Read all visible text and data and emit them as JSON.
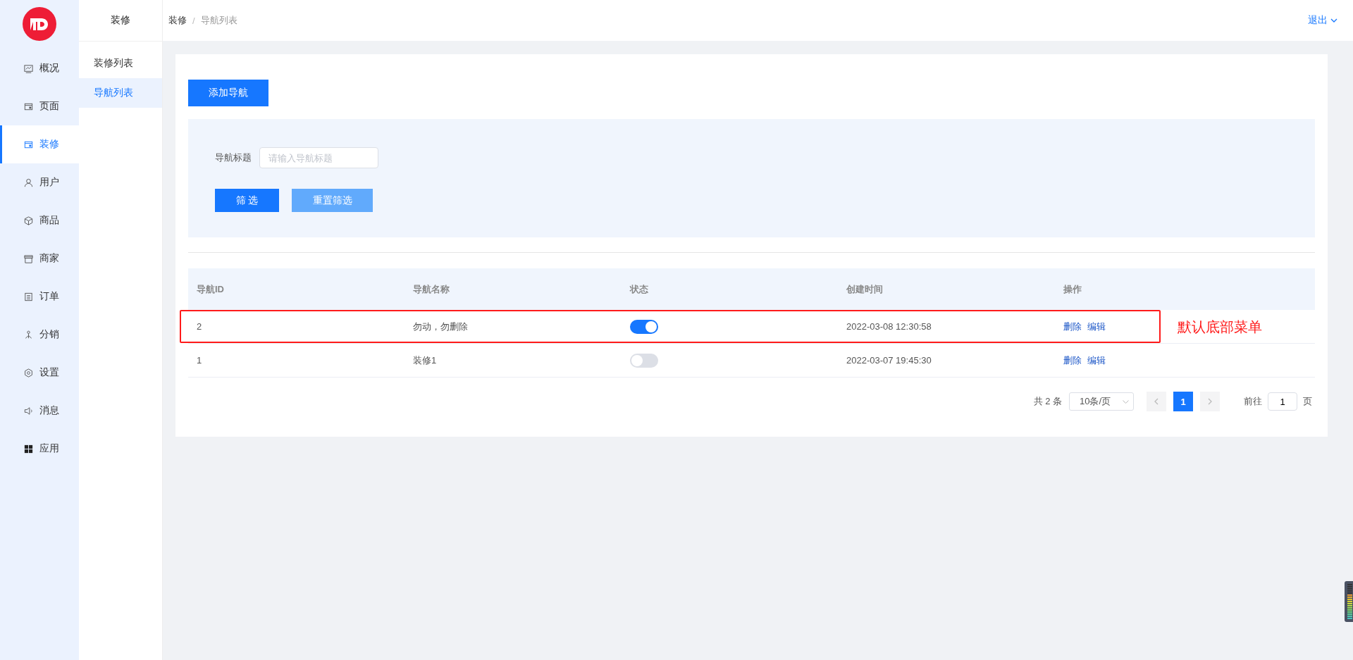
{
  "sidebar": {
    "items": [
      {
        "label": "概况",
        "selected": false
      },
      {
        "label": "页面",
        "selected": false
      },
      {
        "label": "装修",
        "selected": true
      },
      {
        "label": "用户",
        "selected": false
      },
      {
        "label": "商品",
        "selected": false
      },
      {
        "label": "商家",
        "selected": false
      },
      {
        "label": "订单",
        "selected": false
      },
      {
        "label": "分销",
        "selected": false
      },
      {
        "label": "设置",
        "selected": false
      },
      {
        "label": "消息",
        "selected": false
      },
      {
        "label": "应用",
        "selected": false
      }
    ]
  },
  "subnav": {
    "title": "装修",
    "items": [
      {
        "label": "装修列表",
        "selected": false
      },
      {
        "label": "导航列表",
        "selected": true
      }
    ]
  },
  "breadcrumb": {
    "items": [
      "装修",
      "导航列表"
    ],
    "separator": "/"
  },
  "user_menu": {
    "label": "退出"
  },
  "add_button": "添加导航",
  "filter": {
    "label": "导航标题",
    "placeholder": "请输入导航标题",
    "submit": "筛 选",
    "reset": "重置筛选"
  },
  "table": {
    "columns": [
      "导航ID",
      "导航名称",
      "状态",
      "创建时间",
      "操作"
    ],
    "rows": [
      {
        "id": "2",
        "name": "勿动，勿删除",
        "on": true,
        "created": "2022-03-08 12:30:58",
        "actions": [
          "删除",
          "编辑"
        ],
        "highlighted": true
      },
      {
        "id": "1",
        "name": "装修1",
        "on": false,
        "created": "2022-03-07 19:45:30",
        "actions": [
          "删除",
          "编辑"
        ],
        "highlighted": false
      }
    ]
  },
  "annotation": "默认底部菜单",
  "pagination": {
    "total": "共 2 条",
    "page_size": "10条/页",
    "pages": [
      {
        "label": "1",
        "selected": true
      }
    ],
    "goto_label": "前往",
    "goto_value": "1",
    "goto_suffix": "页"
  }
}
